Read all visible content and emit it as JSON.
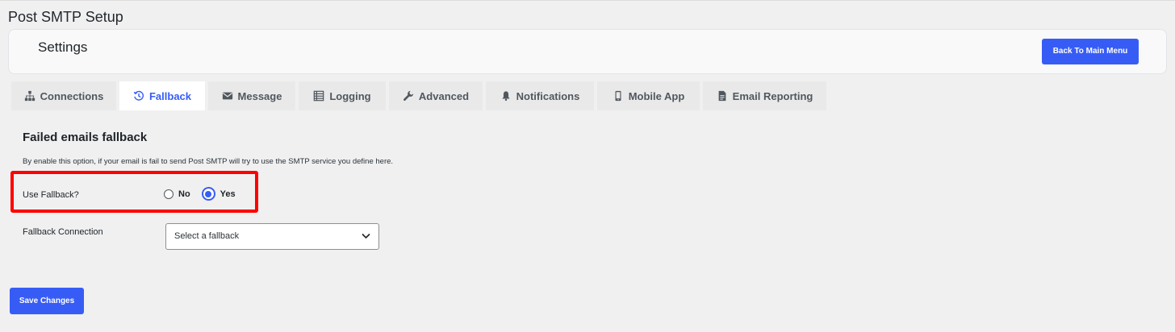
{
  "page": {
    "title": "Post SMTP Setup"
  },
  "header": {
    "title": "Settings",
    "back_button": "Back To Main Menu"
  },
  "tabs": [
    {
      "label": "Connections",
      "icon": "sitemap-icon"
    },
    {
      "label": "Fallback",
      "icon": "history-icon",
      "active": true
    },
    {
      "label": "Message",
      "icon": "envelope-icon"
    },
    {
      "label": "Logging",
      "icon": "list-icon"
    },
    {
      "label": "Advanced",
      "icon": "wrench-icon"
    },
    {
      "label": "Notifications",
      "icon": "bell-icon"
    },
    {
      "label": "Mobile App",
      "icon": "mobile-icon"
    },
    {
      "label": "Email Reporting",
      "icon": "report-icon"
    }
  ],
  "section": {
    "title": "Failed emails fallback",
    "description": "By enable this option, if your email is fail to send Post SMTP will try to use the SMTP service you define here."
  },
  "use_fallback": {
    "label": "Use Fallback?",
    "options": [
      {
        "label": "No",
        "checked": false
      },
      {
        "label": "Yes",
        "checked": true
      }
    ]
  },
  "fallback_connection": {
    "label": "Fallback Connection",
    "selected": "Select a fallback"
  },
  "actions": {
    "save_label": "Save Changes"
  },
  "colors": {
    "accent": "#375cf6",
    "highlight": "#ff0000",
    "background": "#f0f0f1"
  }
}
